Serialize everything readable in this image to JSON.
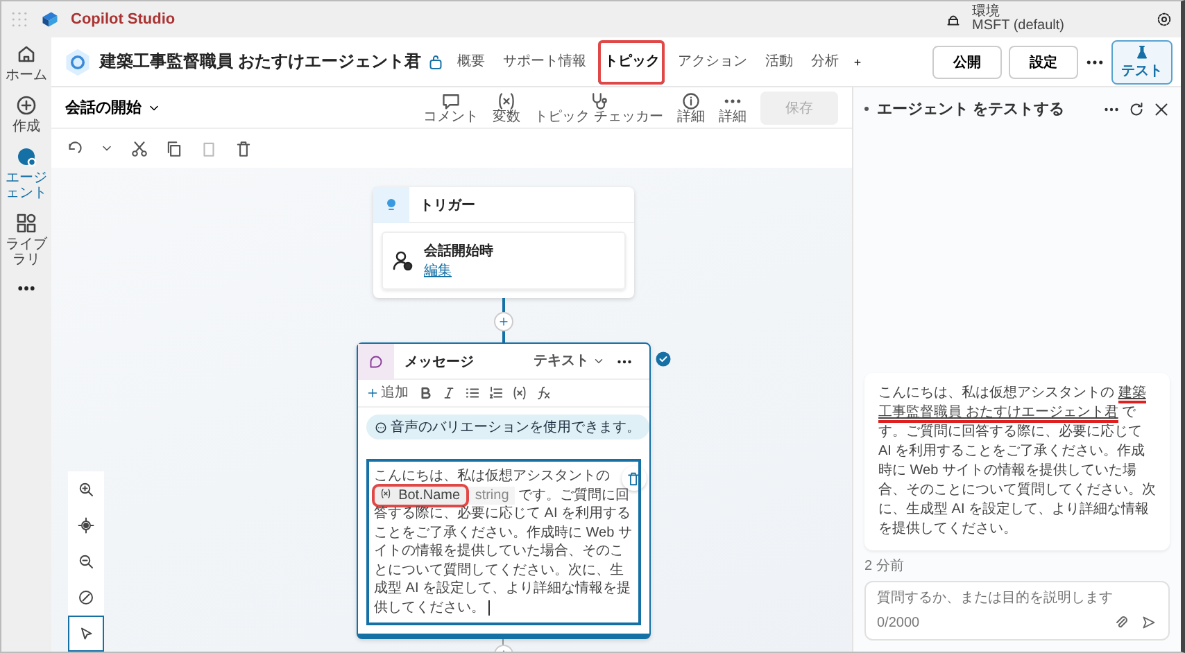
{
  "app": {
    "name": "Copilot Studio"
  },
  "environment": {
    "label": "環境",
    "value": "MSFT (default)"
  },
  "rail": [
    {
      "label": "ホーム",
      "selected": false
    },
    {
      "label": "作成",
      "selected": false
    },
    {
      "label": "エージェント",
      "selected": true
    },
    {
      "label": "ライブラリ",
      "selected": false
    }
  ],
  "agent": {
    "name": "建築工事監督職員 おたすけエージェント君"
  },
  "tabs": [
    {
      "label": "概要",
      "selected": false,
      "annotated": false
    },
    {
      "label": "サポート情報",
      "selected": false,
      "annotated": false
    },
    {
      "label": "トピック",
      "selected": true,
      "annotated": true
    },
    {
      "label": "アクション",
      "selected": false,
      "annotated": false
    },
    {
      "label": "活動",
      "selected": false,
      "annotated": false
    },
    {
      "label": "分析",
      "selected": false,
      "annotated": false
    }
  ],
  "header_buttons": [
    "公開",
    "設定"
  ],
  "test_button": "テスト",
  "topic": {
    "name": "会話の開始",
    "tools": [
      {
        "label": "コメント"
      },
      {
        "label": "変数"
      },
      {
        "label": "トピック チェッカー"
      },
      {
        "label": "詳細"
      },
      {
        "label": "詳細"
      }
    ],
    "save": {
      "label": "保存",
      "disabled": true
    }
  },
  "trigger": {
    "title": "トリガー",
    "event": "会話開始時",
    "link": "編集"
  },
  "message": {
    "title": "メッセージ",
    "type": "テキスト",
    "add": "追加",
    "validated": true,
    "voice_note": "音声のバリエーションを使用できます。",
    "parts": [
      {
        "kind": "text",
        "text": "こんにちは、私は仮想アシスタントの"
      },
      {
        "kind": "variable",
        "name": "Bot.Name",
        "type": "string",
        "annotated": true
      },
      {
        "kind": "text",
        "text": "です。ご質問に回答する際に、必要に応じて AI を利用することをご了承ください。作成時に Web サイトの情報を提供していた場合、そのことについて質問してください。次に、生成型 AI を設定して、より詳細な情報を提供してください。"
      }
    ]
  },
  "test_panel": {
    "title": "エージェント をテストする",
    "messages": [
      {
        "time": "2 分前",
        "parts": [
          {
            "text": "こんにちは、私は仮想アシスタントの ",
            "highlighted": false
          },
          {
            "text": "建築工事監督職員 おたすけエージェント君",
            "highlighted": true
          },
          {
            "text": " です。ご質問に回答する際に、必要に応じて AI を利用することをご了承ください。作成時に Web サイトの情報を提供していた場合、そのことについて質問してください。次に、生成型 AI を設定して、より詳細な情報を提供してください。",
            "highlighted": false
          }
        ]
      }
    ],
    "input": {
      "placeholder": "質問するか、または目的を説明します",
      "counter": "0/2000"
    }
  }
}
